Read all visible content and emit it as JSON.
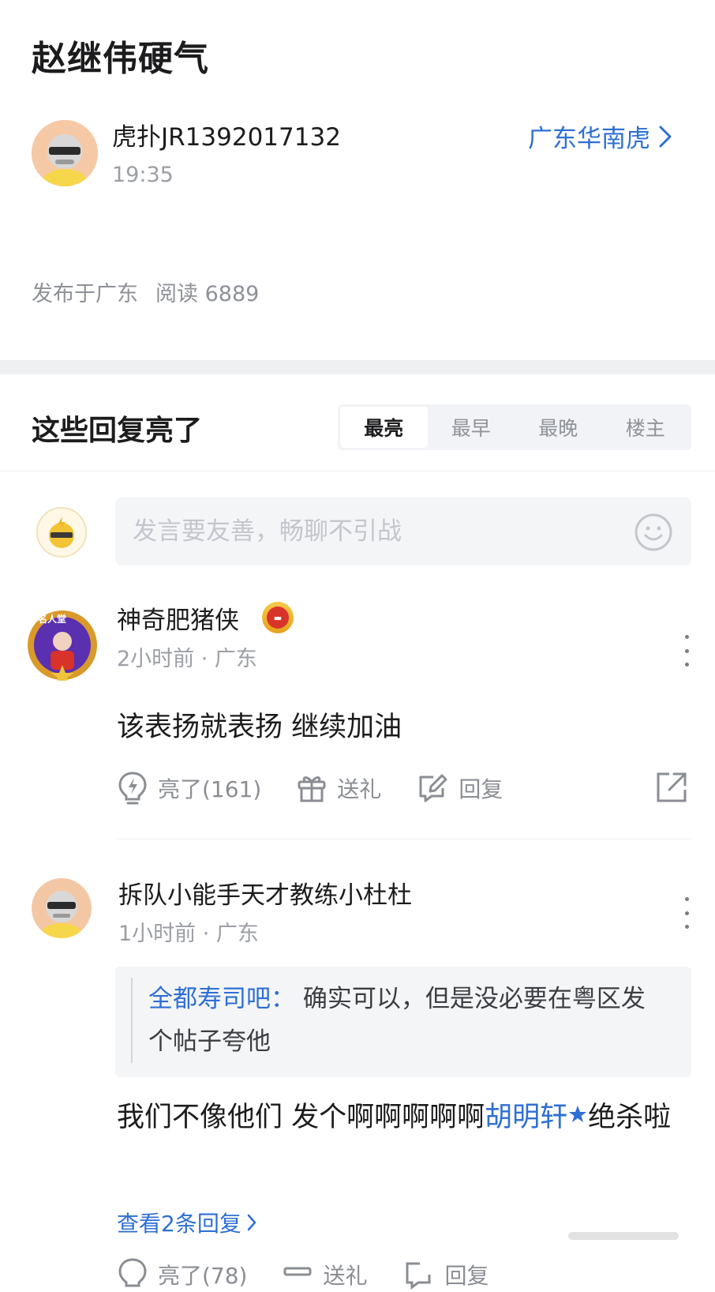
{
  "post": {
    "title": "赵继伟硬气",
    "author": "虎扑JR1392017132",
    "time": "19:35",
    "forum": "广东华南虎",
    "location": "发布于广东",
    "reads": "阅读 6889"
  },
  "replies_header": {
    "title": "这些回复亮了",
    "tabs": [
      "最亮",
      "最早",
      "最晚",
      "楼主"
    ],
    "active_tab": "最亮"
  },
  "composer": {
    "placeholder": "发言要友善，畅聊不引战"
  },
  "comments": [
    {
      "name": "神奇肥猪侠",
      "meta": "2小时前 · 广东",
      "badge_text": "名人堂",
      "body": "该表扬就表扬 继续加油",
      "actions": {
        "like": "亮了(161)",
        "gift": "送礼",
        "reply": "回复"
      }
    },
    {
      "name": "拆队小能手天才教练小杜杜",
      "meta": "1小时前 · 广东",
      "quote": {
        "author": "全都寿司吧：",
        "text": "确实可以，但是没必要在粤区发个帖子夸他"
      },
      "body_before": "我们不像他们 发个啊啊啊啊啊",
      "mention": "胡明轩",
      "body_after": "绝杀啦",
      "view_replies": "查看2条回复",
      "actions": {
        "like": "亮了(78)",
        "gift": "送礼",
        "reply": "回复"
      }
    }
  ],
  "colors": {
    "accent": "#2e6fd4",
    "muted": "#8a8d93",
    "background": "#ffffff"
  }
}
